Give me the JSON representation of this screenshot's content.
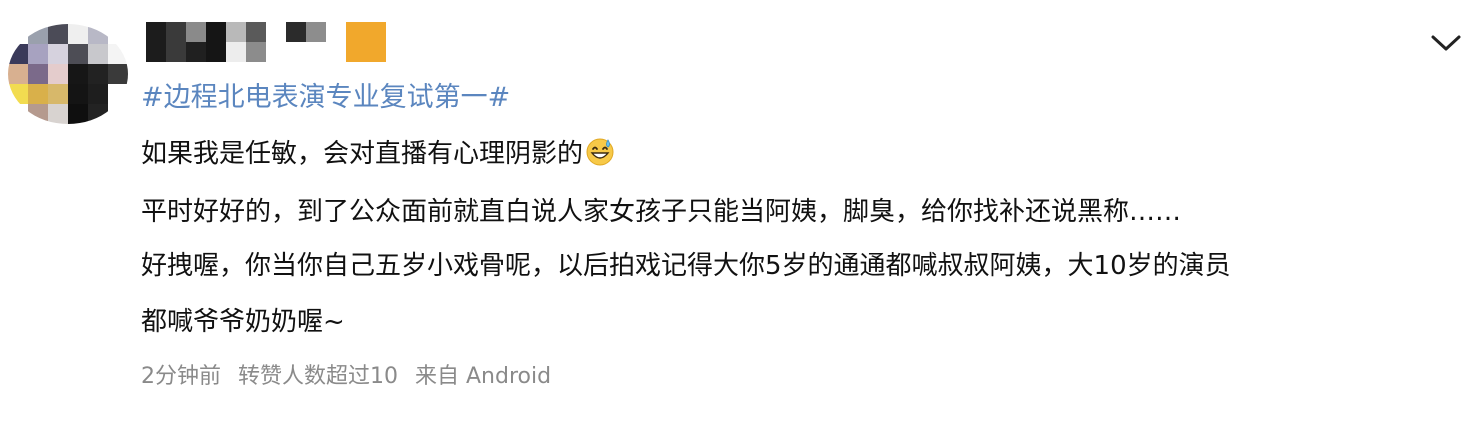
{
  "post": {
    "hashtag": "#边程北电表演专业复试第一#",
    "lines": [
      "如果我是任敏，会对直播有心理阴影的",
      "平时好好的，到了公众面前就直白说人家女孩子只能当阿姨，脚臭，给你找补还说黑称……",
      "好拽喔，你当你自己五岁小戏骨呢，以后拍戏记得大你5岁的通通都喊叔叔阿姨，大10岁的演员",
      "都喊爷爷奶奶喔~"
    ],
    "emoji": "sweat-smile-emoji",
    "meta": {
      "time": "2分钟前",
      "reposts": "转赞人数超过10",
      "source": "来自 Android"
    }
  },
  "icons": {
    "expand": "chevron-down-icon"
  },
  "colors": {
    "hashtag": "#5b86bf",
    "text": "#111111",
    "meta": "#8a8a8a"
  }
}
